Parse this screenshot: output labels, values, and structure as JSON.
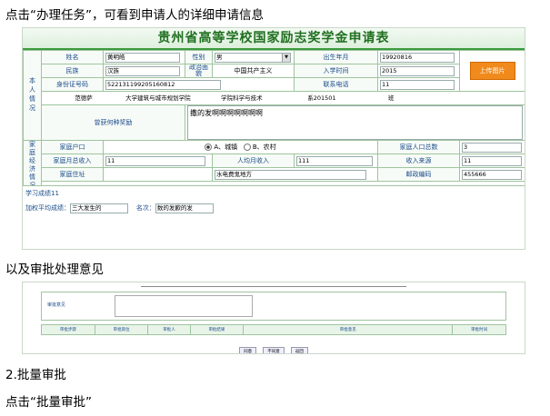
{
  "doc": {
    "line1": "点击“办理任务”，可看到申请人的详细申请信息",
    "line2": "以及审批处理意见",
    "line3": "2.批量审批",
    "line4": "点击“批量审批”"
  },
  "form": {
    "title": "贵州省高等学校国家励志奖学金申请表",
    "personal_section": "本人情况",
    "name_label": "姓名",
    "name_value": "黄明皓",
    "gender_label": "性别",
    "gender_value": "男",
    "birth_label": "出生年月",
    "birth_value": "19920816",
    "ethnic_label": "民族",
    "ethnic_value": "汉族",
    "political_label": "政治面貌",
    "political_value": "中国共产主义",
    "enroll_label": "入学时间",
    "enroll_value": "2015",
    "upload_label": "上传图片",
    "id_label": "身份证号码",
    "id_value": "522131199205160812",
    "phone_label": "联系电话",
    "phone_value": "11",
    "school_value": "范德萨",
    "university_label": "大学",
    "college_value": "建筑与城市规划学院",
    "school_label": "学院",
    "major_value": "科学与技术",
    "department_label": "系",
    "class_value": "201501",
    "class_label": "班",
    "awards_label": "曾获何种奖励",
    "awards_value": "撒的发啊啊啊啊啊啊啊",
    "family_section": "家庭经济情况",
    "hukou_label": "家庭户口",
    "hukou_opt_a": "A、城镇",
    "hukou_opt_b": "B、农村",
    "pop_label": "家庭人口总数",
    "pop_value": "3",
    "monthly_label": "家庭月总收入",
    "monthly_value": "11",
    "percap_label": "人均月收入",
    "percap_value": "111",
    "income_src_label": "收入来源",
    "income_src_value": "11",
    "address_label": "家庭住址",
    "address_value": "水电费鬼地方",
    "postcode_label": "邮政编码",
    "postcode_value": "455666",
    "score_label": "学习成绩",
    "score_value": "11",
    "gpa_label": "加权平均成绩：",
    "gpa_value": "三大发生的",
    "rank_label": "名次：",
    "rank_value": "数的发歉的发"
  },
  "approval": {
    "opinion_label": "审批意见",
    "headers": [
      "审批步骤",
      "审批岗位",
      "审批人",
      "审批结果",
      "审批意见",
      "审批时间"
    ],
    "buttons": [
      "同意",
      "不同意",
      "返回"
    ]
  }
}
